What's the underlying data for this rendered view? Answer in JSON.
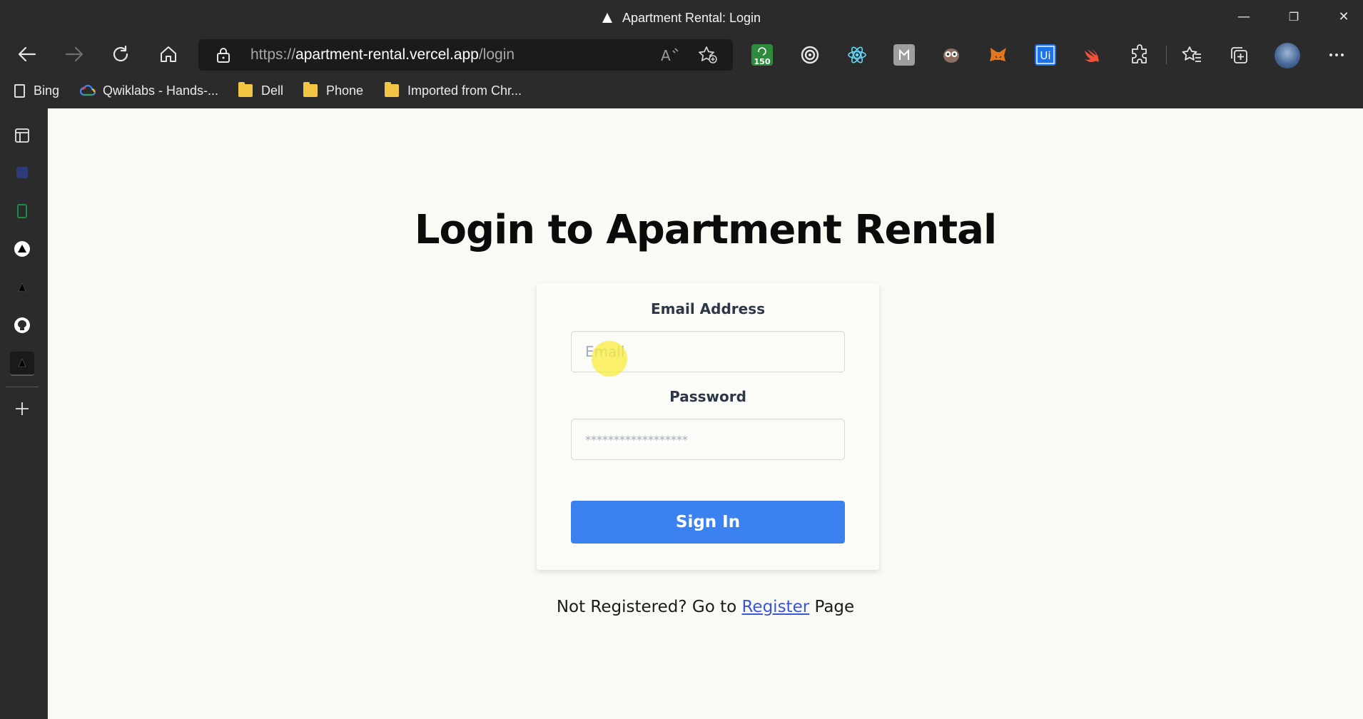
{
  "window": {
    "title": "Apartment Rental: Login",
    "minimize_glyph": "—",
    "restore_glyph": "❐",
    "close_glyph": "✕"
  },
  "toolbar": {
    "url_scheme": "https://",
    "url_host": "apartment-rental.vercel.app",
    "url_path": "/login",
    "extension_badge": "150",
    "icons": [
      "back-icon",
      "forward-icon",
      "refresh-icon",
      "home-icon",
      "lock-icon",
      "read-aloud-icon",
      "add-favorite-icon",
      "extensions-icon",
      "favorites-icon",
      "collections-icon",
      "profile-avatar",
      "more-menu-icon"
    ]
  },
  "bookmarks": [
    {
      "label": "Bing",
      "icon": "page-icon"
    },
    {
      "label": "Qwiklabs - Hands-...",
      "icon": "google-cloud-icon"
    },
    {
      "label": "Dell",
      "icon": "folder-icon"
    },
    {
      "label": "Phone",
      "icon": "folder-icon"
    },
    {
      "label": "Imported from Chr...",
      "icon": "folder-icon"
    }
  ],
  "page": {
    "heading": "Login to Apartment Rental",
    "email_label": "Email Address",
    "email_placeholder": "Email",
    "password_label": "Password",
    "password_placeholder": "******************",
    "signin_label": "Sign In",
    "footer_prefix": "Not Registered? Go to ",
    "footer_link": "Register",
    "footer_suffix": " Page"
  },
  "colors": {
    "browser_chrome": "#2b2b2b",
    "page_background": "#fafaf5",
    "primary_button": "#3b82f0",
    "link": "#3a56d4"
  }
}
